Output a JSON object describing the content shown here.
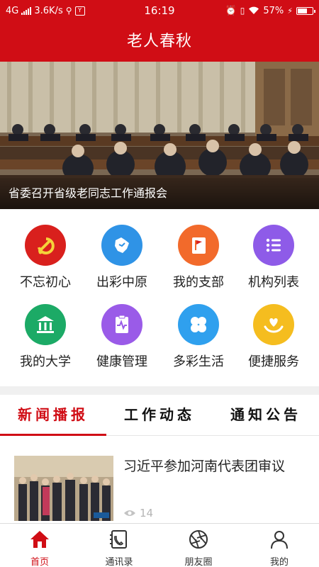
{
  "status_bar": {
    "network": "4G",
    "speed": "3.6K/s",
    "time": "16:19",
    "battery_percent": "57%",
    "battery_level": 0.57,
    "bg_color": "#d00d15"
  },
  "header": {
    "title": "老人春秋"
  },
  "banner": {
    "caption": "省委召开省级老同志工作通报会"
  },
  "grid": {
    "items": [
      {
        "label": "不忘初心",
        "icon": "party-emblem-icon",
        "color": "#d9201d"
      },
      {
        "label": "出彩中原",
        "icon": "province-map-icon",
        "color": "#2f93e6"
      },
      {
        "label": "我的支部",
        "icon": "flag-book-icon",
        "color": "#f26a2b"
      },
      {
        "label": "机构列表",
        "icon": "list-icon",
        "color": "#8e5be8"
      },
      {
        "label": "我的大学",
        "icon": "university-icon",
        "color": "#1caa66"
      },
      {
        "label": "健康管理",
        "icon": "health-clipboard-icon",
        "color": "#9a5be8"
      },
      {
        "label": "多彩生活",
        "icon": "clover-icon",
        "color": "#2fa0ee"
      },
      {
        "label": "便捷服务",
        "icon": "heart-hands-icon",
        "color": "#f5bd1f"
      }
    ]
  },
  "tabs": {
    "items": [
      "新闻播报",
      "工作动态",
      "通知公告"
    ],
    "active_index": 0
  },
  "news": {
    "items": [
      {
        "title": "习近平参加河南代表团审议",
        "views": "14"
      }
    ]
  },
  "bottom_nav": {
    "items": [
      {
        "label": "首页",
        "icon": "home-icon"
      },
      {
        "label": "通讯录",
        "icon": "contacts-icon"
      },
      {
        "label": "朋友圈",
        "icon": "aperture-icon"
      },
      {
        "label": "我的",
        "icon": "user-icon"
      }
    ],
    "active_index": 0,
    "accent_color": "#d00d15"
  }
}
